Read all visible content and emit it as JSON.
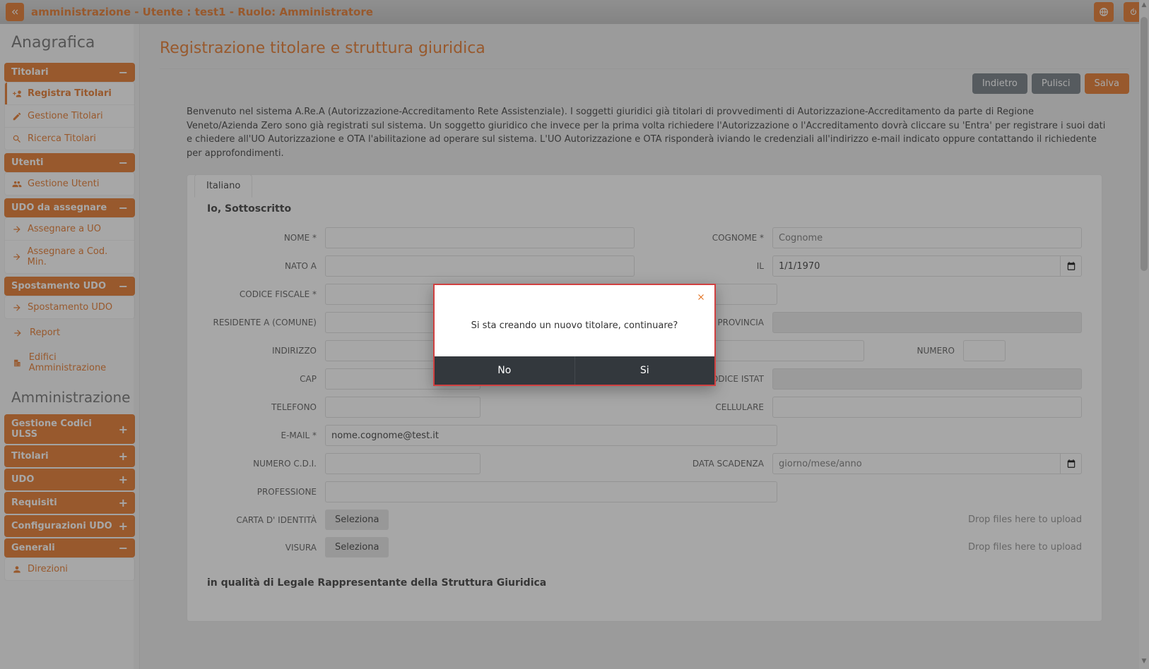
{
  "topbar": {
    "title": "amministrazione - Utente : test1 - Ruolo: Amministratore"
  },
  "sidebar": {
    "h1": "Anagrafica",
    "titolari": {
      "header": "Titolari",
      "items": [
        "Registra Titolari",
        "Gestione Titolari",
        "Ricerca Titolari"
      ]
    },
    "utenti": {
      "header": "Utenti",
      "items": [
        "Gestione Utenti"
      ]
    },
    "udo": {
      "header": "UDO da assegnare",
      "items": [
        "Assegnare a UO",
        "Assegnare a Cod. Min."
      ]
    },
    "spost": {
      "header": "Spostamento UDO",
      "items": [
        "Spostamento UDO"
      ]
    },
    "links": [
      "Report",
      "Edifici Amministrazione"
    ],
    "h2": "Amministrazione",
    "collapsed": [
      "Gestione Codici ULSS",
      "Titolari",
      "UDO",
      "Requisiti",
      "Configurazioni UDO"
    ],
    "generali": {
      "header": "Generali",
      "items": [
        "Direzioni"
      ]
    }
  },
  "page": {
    "title": "Registrazione titolare e struttura giuridica",
    "actions": {
      "back": "Indietro",
      "clear": "Pulisci",
      "save": "Salva"
    },
    "intro": "Benvenuto nel sistema A.Re.A (Autorizzazione-Accreditamento Rete Assistenziale). I soggetti giuridici già titolari di provvedimenti di Autorizzazione-Accreditamento da parte di Regione Veneto/Azienda Zero sono già registrati sul sistema. Un soggetto giuridico che invece per la prima volta richiedere l'Autorizzazione o l'Accreditamento dovrà cliccare su 'Entra' per registrare i suoi dati e chiedere all'UO Autorizzazione e OTA l'abilitazione ad operare sul sistema. L'UO Autorizzazione e OTA risponderà iviando le credenziali all'indirizzo e-mail indicato oppure contattando il richiedente per approfondimenti.",
    "tab": "Italiano",
    "section1": "Io, Sottoscritto",
    "labels": {
      "nome": "NOME *",
      "cognome": "COGNOME *",
      "natoa": "NATO A",
      "il": "IL",
      "cf": "CODICE FISCALE *",
      "residenteA": "RESIDENTE A (COMUNE)",
      "provincia": "PROVINCIA",
      "indirizzo": "INDIRIZZO",
      "numero": "NUMERO",
      "cap": "CAP",
      "istat": "CODICE ISTAT",
      "tel": "TELEFONO",
      "cell": "CELLULARE",
      "email": "E-MAIL *",
      "cdi": "NUMERO C.D.I.",
      "scad": "DATA SCADENZA",
      "prof": "PROFESSIONE",
      "carta": "CARTA D' IDENTITÀ",
      "visura": "VISURA"
    },
    "values": {
      "cognome_ph": "Cognome",
      "il_val": "1/1/1970",
      "email_val": "nome.cognome@test.it",
      "scad_ph": "giorno/mese/anno"
    },
    "file": {
      "btn": "Seleziona",
      "drop": "Drop files here to upload"
    },
    "section2": "in qualità di Legale Rappresentante della Struttura Giuridica"
  },
  "modal": {
    "message": "Si sta creando un nuovo titolare, continuare?",
    "no": "No",
    "si": "Si"
  }
}
